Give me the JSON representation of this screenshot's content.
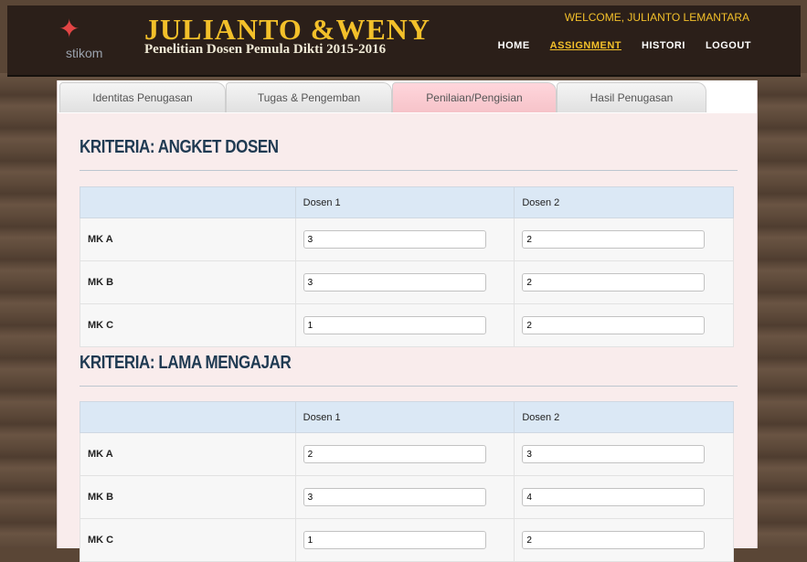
{
  "header": {
    "logo_text": "stikom",
    "title": "JULIANTO &WENY",
    "subtitle": "Penelitian Dosen Pemula Dikti 2015-2016",
    "welcome": "WELCOME, JULIANTO LEMANTARA",
    "nav": [
      {
        "label": "HOME",
        "active": false
      },
      {
        "label": "ASSIGNMENT",
        "active": true
      },
      {
        "label": "HISTORI",
        "active": false
      },
      {
        "label": "LOGOUT",
        "active": false
      }
    ]
  },
  "tabs": [
    {
      "label": "Identitas Penugasan",
      "active": false
    },
    {
      "label": "Tugas & Pengemban",
      "active": false
    },
    {
      "label": "Penilaian/Pengisian",
      "active": true
    },
    {
      "label": "Hasil Penugasan",
      "active": false
    }
  ],
  "sections": [
    {
      "title": "KRITERIA: ANGKET DOSEN",
      "columns": [
        "",
        "Dosen 1",
        "Dosen 2"
      ],
      "rows": [
        {
          "label": "MK A",
          "d1": "3",
          "d2": "2"
        },
        {
          "label": "MK B",
          "d1": "3",
          "d2": "2"
        },
        {
          "label": "MK C",
          "d1": "1",
          "d2": "2"
        }
      ]
    },
    {
      "title": "KRITERIA: LAMA MENGAJAR",
      "columns": [
        "",
        "Dosen 1",
        "Dosen 2"
      ],
      "rows": [
        {
          "label": "MK A",
          "d1": "2",
          "d2": "3"
        },
        {
          "label": "MK B",
          "d1": "3",
          "d2": "4"
        },
        {
          "label": "MK C",
          "d1": "1",
          "d2": "2"
        }
      ]
    }
  ],
  "colors": {
    "accent": "#f3c02a",
    "header_bg": "#2b1f19",
    "table_head": "#dbe8f5",
    "active_tab": "#f6c3c9"
  }
}
